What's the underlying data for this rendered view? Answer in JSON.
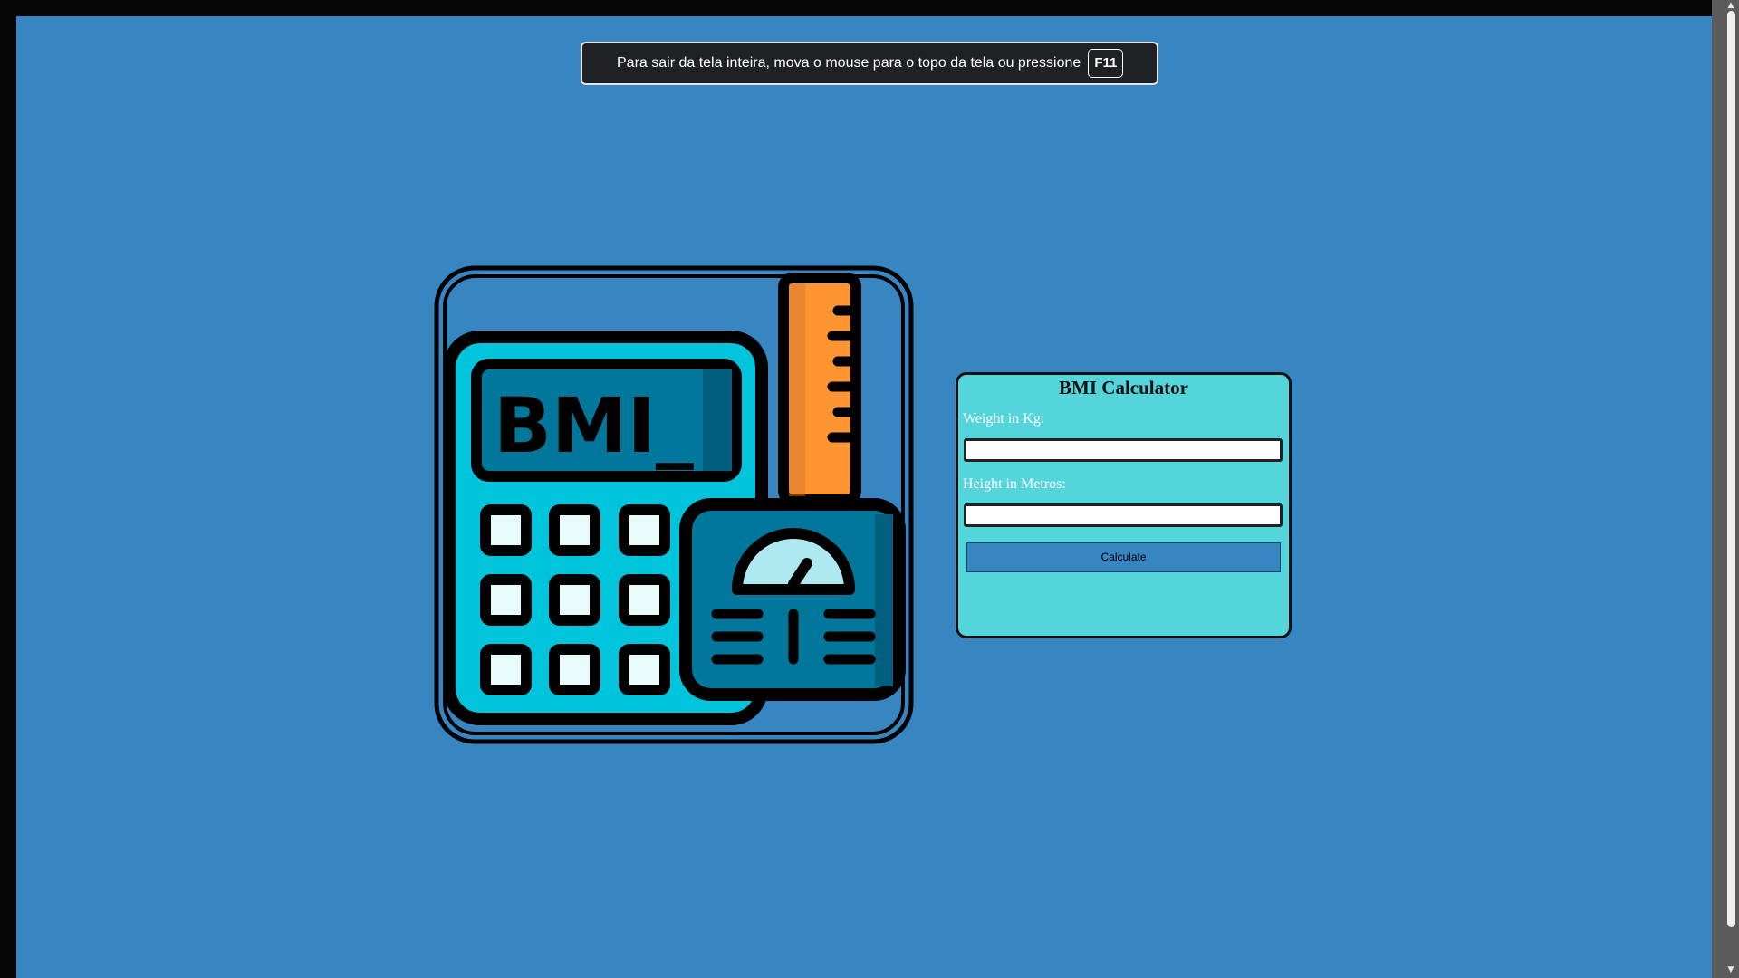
{
  "fullscreen_notice": {
    "message": "Para sair da tela inteira, mova o mouse para o topo da tela ou pressione",
    "key": "F11"
  },
  "illustration": {
    "screen_text": "BMI_",
    "icon": "calculator-scale-ruler-icon"
  },
  "bmi_form": {
    "title": "BMI Calculator",
    "weight_label": "Weight in Kg:",
    "weight_value": "",
    "height_label": "Height in Metros:",
    "height_value": "",
    "calculate_label": "Calculate"
  },
  "colors": {
    "page_background": "#3786c1",
    "card_background": "#54d5db",
    "calculator_body": "#00c3dc",
    "calculator_screen": "#00779b",
    "ruler": "#ff9532"
  }
}
